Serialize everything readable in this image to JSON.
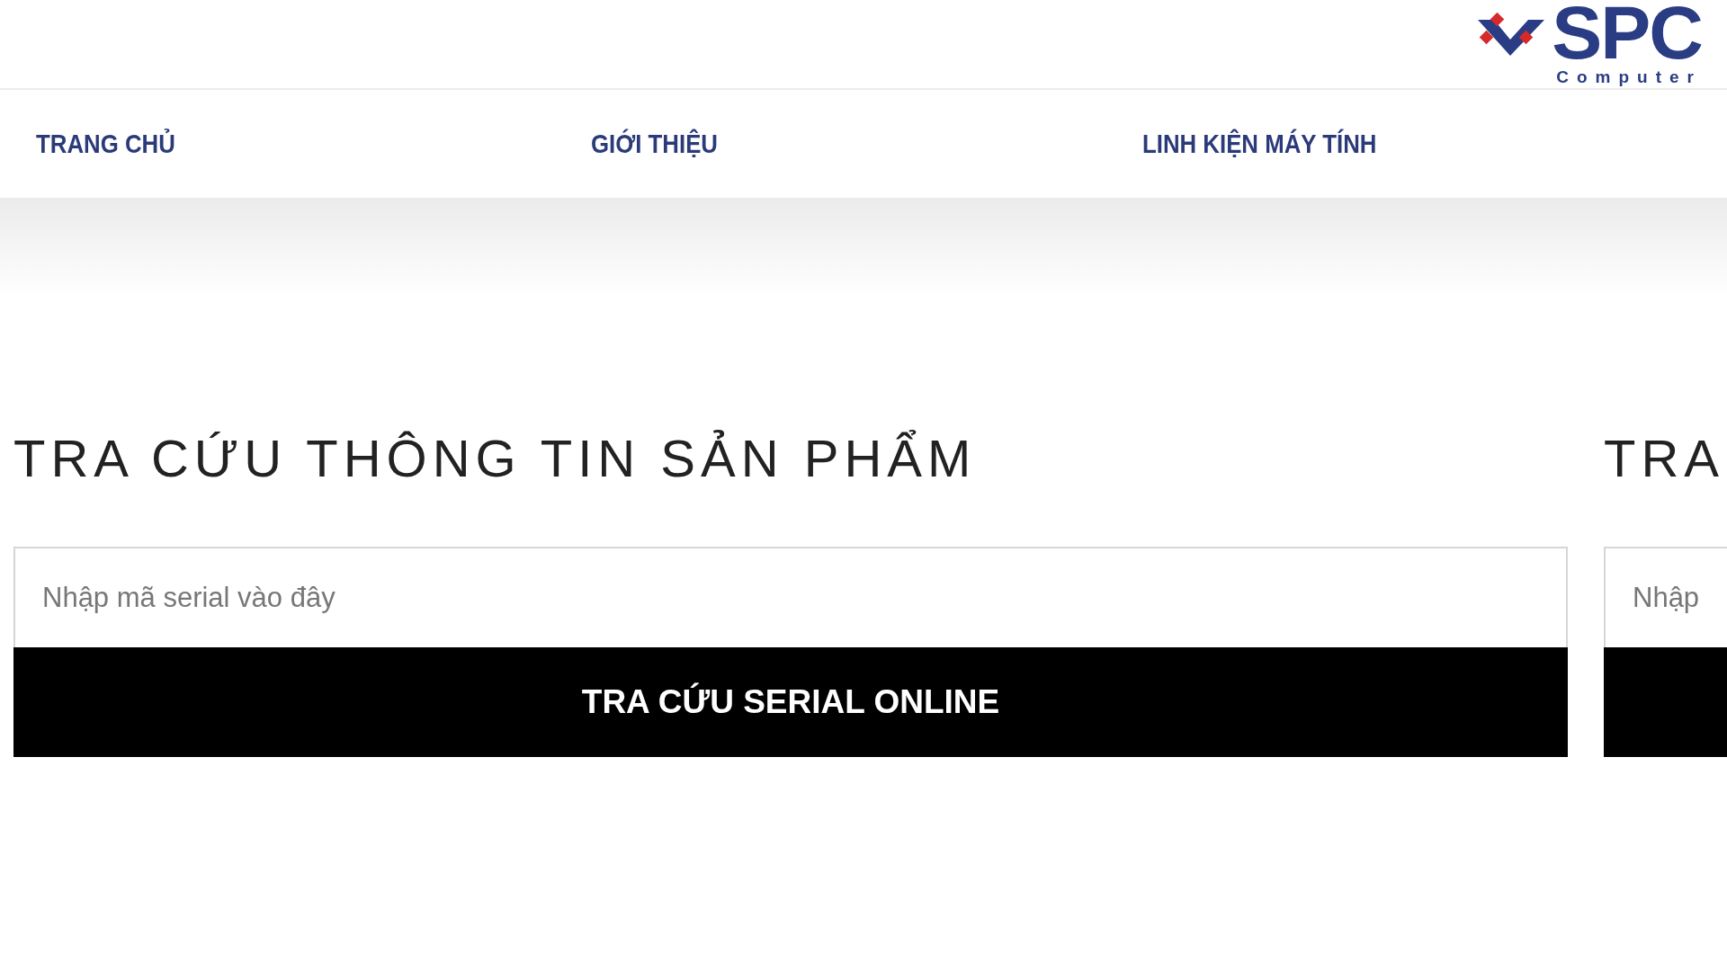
{
  "logo": {
    "name": "SPC",
    "tagline": "Computer"
  },
  "nav": [
    {
      "label": "TRANG CHỦ"
    },
    {
      "label": "GIỚI THIỆU"
    },
    {
      "label": "LINH KIỆN MÁY TÍNH"
    }
  ],
  "lookups": [
    {
      "title": "TRA CỨU THÔNG TIN SẢN PHẨM",
      "placeholder": "Nhập mã serial vào đây",
      "button": "TRA CỨU SERIAL ONLINE"
    },
    {
      "title": "TRA",
      "placeholder": "Nhập"
    }
  ]
}
